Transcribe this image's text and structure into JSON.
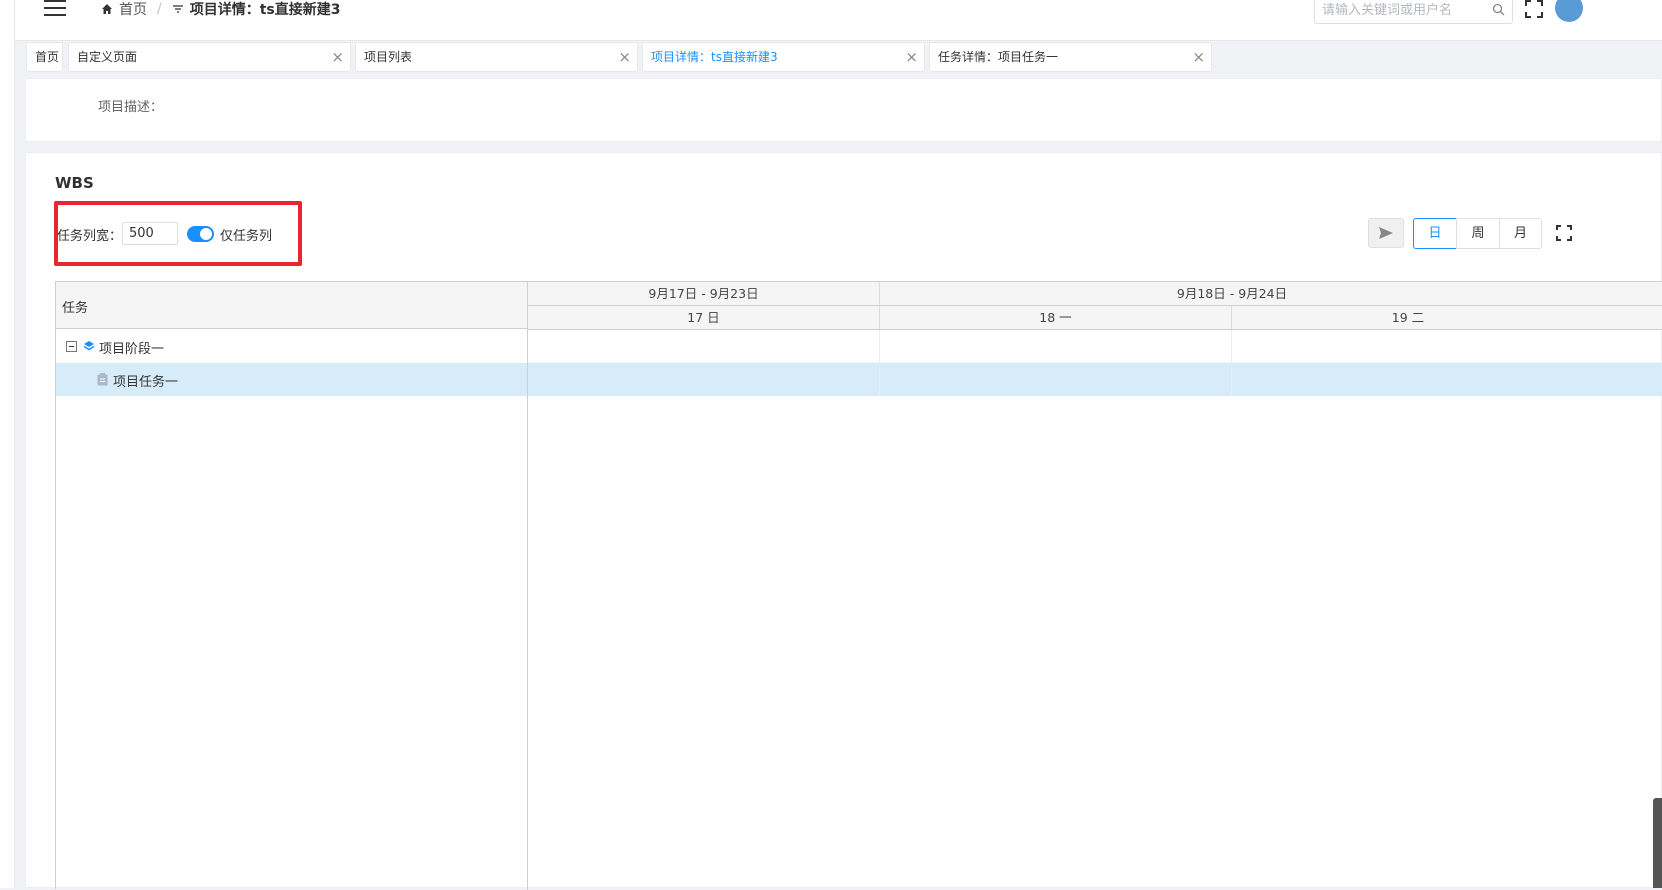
{
  "header": {
    "breadcrumb": [
      "首页",
      "项目详情：ts直接新建3"
    ],
    "search_placeholder": "请输入关键词或用户名"
  },
  "tabs": [
    {
      "label": "首页",
      "closable": false,
      "active": false
    },
    {
      "label": "自定义页面",
      "closable": true,
      "active": false
    },
    {
      "label": "项目列表",
      "closable": true,
      "active": false
    },
    {
      "label": "项目详情：ts直接新建3",
      "closable": true,
      "active": true
    },
    {
      "label": "任务详情：项目任务一",
      "closable": true,
      "active": false
    }
  ],
  "project": {
    "desc_label": "项目描述："
  },
  "wbs": {
    "title": "WBS",
    "width_label": "任务列宽：",
    "width_value": "500",
    "toggle_label": "仅任务列",
    "toggle_on": true,
    "scale_buttons": [
      "日",
      "周",
      "月"
    ],
    "active_scale": "日"
  },
  "gantt": {
    "task_header": "任务",
    "weeks": [
      "9月17日 - 9月23日",
      "9月18日 - 9月24日"
    ],
    "days": [
      "17 日",
      "18 一",
      "19 二"
    ],
    "tasks": [
      {
        "label": "项目阶段一",
        "type": "phase",
        "selected": false
      },
      {
        "label": "项目任务一",
        "type": "task",
        "selected": true
      }
    ]
  },
  "colors": {
    "accent": "#1890ff",
    "highlight_box": "#e8262f",
    "selected_row": "#d6ecf8"
  }
}
